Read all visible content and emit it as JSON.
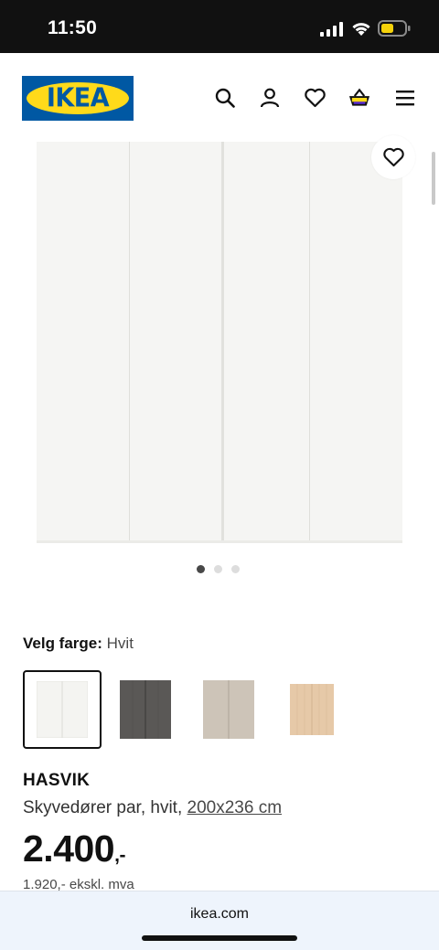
{
  "status": {
    "time": "11:50"
  },
  "header": {
    "logo_text": "IKEA",
    "icons": [
      "search-icon",
      "account-icon",
      "heart-icon",
      "cart-icon",
      "menu-icon"
    ]
  },
  "gallery": {
    "image_count": 3,
    "active_index": 0
  },
  "color_select": {
    "label": "Velg farge:",
    "value": "Hvit",
    "swatches": [
      {
        "name": "Hvit",
        "color": "#f4f4f1",
        "selected": true
      },
      {
        "name": "Mørk grå",
        "color": "#5a5856",
        "selected": false
      },
      {
        "name": "Beige",
        "color": "#cdc4b8",
        "selected": false
      },
      {
        "name": "Lys eik",
        "color": "#e6c9a8",
        "selected": false
      }
    ]
  },
  "product": {
    "name": "HASVIK",
    "description": "Skyvedører par, hvit,",
    "size_link": "200x236 cm",
    "price": "2.400",
    "price_suffix": ",-",
    "ex_vat": "1.920,- ekskl. mva"
  },
  "browser": {
    "url": "ikea.com"
  },
  "colors": {
    "brand_blue": "#0058a3",
    "brand_yellow": "#ffda1a"
  }
}
